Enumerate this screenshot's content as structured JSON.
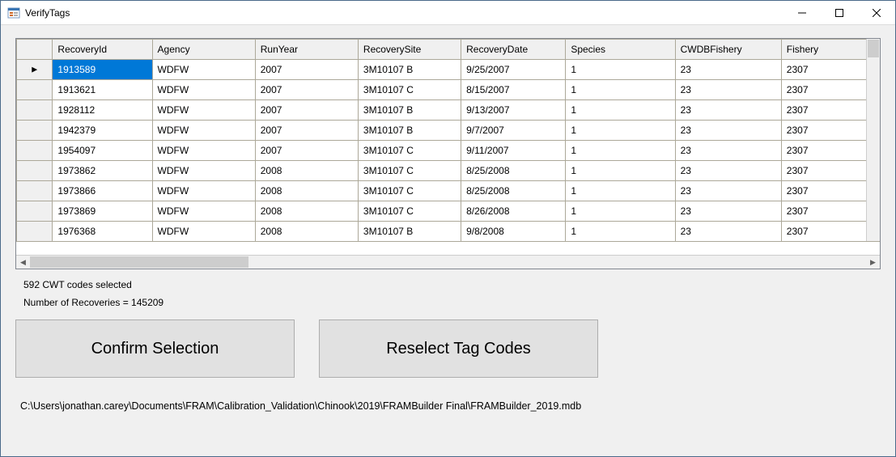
{
  "window": {
    "title": "VerifyTags"
  },
  "grid": {
    "columns": [
      "RecoveryId",
      "Agency",
      "RunYear",
      "RecoverySite",
      "RecoveryDate",
      "Species",
      "CWDBFishery",
      "Fishery"
    ],
    "rows": [
      {
        "RecoveryId": "1913589",
        "Agency": "WDFW",
        "RunYear": "2007",
        "RecoverySite": "3M10107 B",
        "RecoveryDate": "9/25/2007",
        "Species": "1",
        "CWDBFishery": "23",
        "Fishery": "2307"
      },
      {
        "RecoveryId": "1913621",
        "Agency": "WDFW",
        "RunYear": "2007",
        "RecoverySite": "3M10107 C",
        "RecoveryDate": "8/15/2007",
        "Species": "1",
        "CWDBFishery": "23",
        "Fishery": "2307"
      },
      {
        "RecoveryId": "1928112",
        "Agency": "WDFW",
        "RunYear": "2007",
        "RecoverySite": "3M10107 B",
        "RecoveryDate": "9/13/2007",
        "Species": "1",
        "CWDBFishery": "23",
        "Fishery": "2307"
      },
      {
        "RecoveryId": "1942379",
        "Agency": "WDFW",
        "RunYear": "2007",
        "RecoverySite": "3M10107 B",
        "RecoveryDate": "9/7/2007",
        "Species": "1",
        "CWDBFishery": "23",
        "Fishery": "2307"
      },
      {
        "RecoveryId": "1954097",
        "Agency": "WDFW",
        "RunYear": "2007",
        "RecoverySite": "3M10107 C",
        "RecoveryDate": "9/11/2007",
        "Species": "1",
        "CWDBFishery": "23",
        "Fishery": "2307"
      },
      {
        "RecoveryId": "1973862",
        "Agency": "WDFW",
        "RunYear": "2008",
        "RecoverySite": "3M10107 C",
        "RecoveryDate": "8/25/2008",
        "Species": "1",
        "CWDBFishery": "23",
        "Fishery": "2307"
      },
      {
        "RecoveryId": "1973866",
        "Agency": "WDFW",
        "RunYear": "2008",
        "RecoverySite": "3M10107 C",
        "RecoveryDate": "8/25/2008",
        "Species": "1",
        "CWDBFishery": "23",
        "Fishery": "2307"
      },
      {
        "RecoveryId": "1973869",
        "Agency": "WDFW",
        "RunYear": "2008",
        "RecoverySite": "3M10107 C",
        "RecoveryDate": "8/26/2008",
        "Species": "1",
        "CWDBFishery": "23",
        "Fishery": "2307"
      },
      {
        "RecoveryId": "1976368",
        "Agency": "WDFW",
        "RunYear": "2008",
        "RecoverySite": "3M10107 B",
        "RecoveryDate": "9/8/2008",
        "Species": "1",
        "CWDBFishery": "23",
        "Fishery": "2307"
      }
    ],
    "selectedRow": 0,
    "selectedCol": 0
  },
  "status": {
    "codes_selected": "592 CWT codes selected",
    "recoveries": "Number of Recoveries = 145209"
  },
  "buttons": {
    "confirm": "Confirm Selection",
    "reselect": "Reselect Tag Codes"
  },
  "path": "C:\\Users\\jonathan.carey\\Documents\\FRAM\\Calibration_Validation\\Chinook\\2019\\FRAMBuilder Final\\FRAMBuilder_2019.mdb"
}
